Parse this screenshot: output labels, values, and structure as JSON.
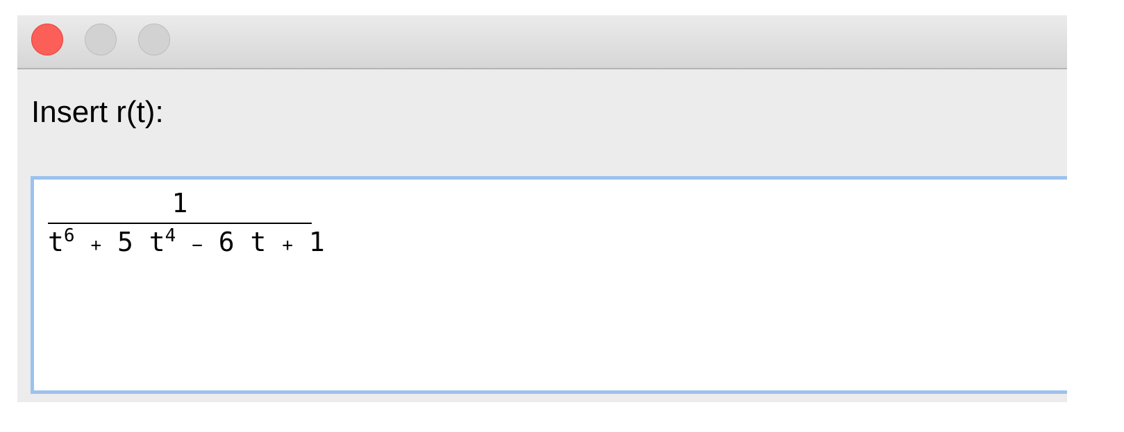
{
  "window": {
    "buttons": {
      "close": "close",
      "minimize": "minimize",
      "zoom": "zoom"
    },
    "colors": {
      "close": "#fc5f57",
      "inactive": "#d2d2d2",
      "focus_ring": "#9cc2ee"
    }
  },
  "prompt": {
    "label": "Insert r(t):"
  },
  "expression_input": {
    "numerator": "1",
    "denominator": {
      "term1_base": "t",
      "term1_exp": "6",
      "op1": "+",
      "term2_coef": "5",
      "term2_base": "t",
      "term2_exp": "4",
      "op2": "−",
      "term3_coef": "6",
      "term3_base": "t",
      "op3": "+",
      "term4": "1"
    }
  }
}
